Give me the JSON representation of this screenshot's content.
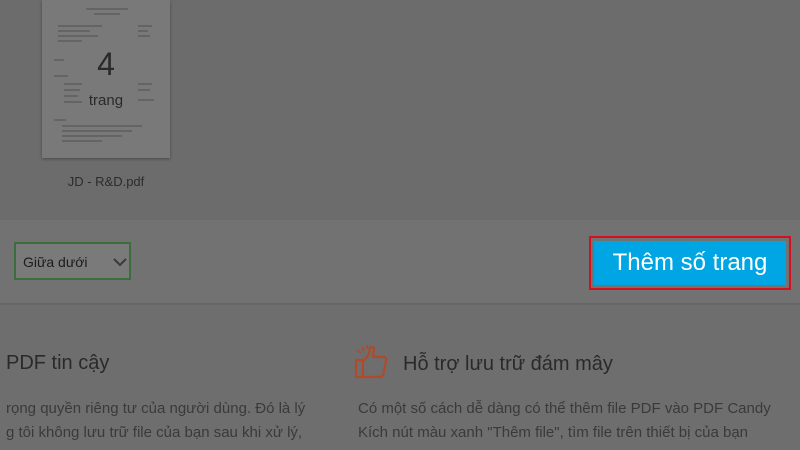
{
  "preview": {
    "page_count": "4",
    "page_unit": "trang",
    "file_name": "JD - R&D.pdf"
  },
  "toolbar": {
    "position_selected": "Giữa dưới",
    "add_page_numbers_label": "Thêm số trang"
  },
  "features": [
    {
      "title": "PDF tin cậy",
      "lines": [
        "rọng quyền riêng tư của người dùng. Đó là lý",
        "g tôi không lưu trữ file của bạn sau khi xử lý,"
      ]
    },
    {
      "title": "Hỗ trợ lưu trữ đám mây",
      "icon": "thumbs-up-icon",
      "lines": [
        "Có một số cách dễ dàng có thể thêm file PDF vào PDF Candy",
        "Kích nút màu xanh \"Thêm file\", tìm file trên thiết bị của bạn"
      ]
    }
  ],
  "colors": {
    "accent_button": "#00a5e3",
    "highlight_border": "#d21020",
    "select_border": "#3c6e3c",
    "icon_orange": "#b04a2a"
  }
}
